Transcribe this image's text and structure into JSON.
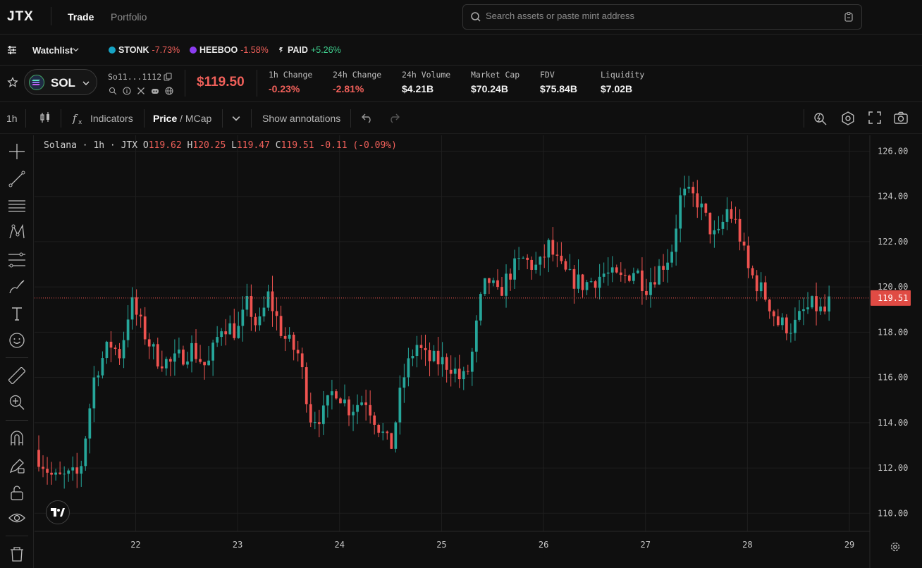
{
  "app": {
    "logo": "JTX",
    "nav": [
      {
        "label": "Trade",
        "active": true
      },
      {
        "label": "Portfolio",
        "active": false
      }
    ],
    "search_placeholder": "Search assets or paste mint address"
  },
  "watchlist": {
    "label": "Watchlist",
    "items": [
      {
        "symbol": "STONK",
        "change": "-7.73%",
        "color": "#16a3c4"
      },
      {
        "symbol": "HEEBOO",
        "change": "-1.58%",
        "color": "#8b3cf0"
      },
      {
        "symbol": "PAID",
        "change": "+5.26%",
        "color": "#cccccc"
      }
    ]
  },
  "token": {
    "symbol": "SOL",
    "address": "So11...1112",
    "price": "$119.50",
    "stats": [
      {
        "label": "1h Change",
        "value": "-0.23%",
        "tone": "neg"
      },
      {
        "label": "24h Change",
        "value": "-2.81%",
        "tone": "neg"
      },
      {
        "label": "24h Volume",
        "value": "$4.21B",
        "tone": "neutral"
      },
      {
        "label": "Market Cap",
        "value": "$70.24B",
        "tone": "neutral"
      },
      {
        "label": "FDV",
        "value": "$75.84B",
        "tone": "neutral"
      },
      {
        "label": "Liquidity",
        "value": "$7.02B",
        "tone": "neutral"
      }
    ]
  },
  "toolbar": {
    "interval": "1h",
    "indicators": "Indicators",
    "price": "Price",
    "slash": " / ",
    "mcap": "MCap",
    "annotations": "Show annotations"
  },
  "legend": {
    "prefix": "Solana · 1h · JTX",
    "o_label": "O",
    "o": "119.62",
    "h_label": "H",
    "h": "120.25",
    "l_label": "L",
    "l": "119.47",
    "c_label": "C",
    "c": "119.51",
    "chg": "-0.11 (-0.09%)"
  },
  "chart_data": {
    "type": "candlestick",
    "title": "",
    "interval": "1h",
    "ylim": [
      109.2,
      126.7
    ],
    "y_ticks": [
      "126.00",
      "124.00",
      "122.00",
      "120.00",
      "118.00",
      "116.00",
      "114.00",
      "112.00",
      "110.00"
    ],
    "x_ticks": [
      "22",
      "23",
      "24",
      "25",
      "26",
      "27",
      "28",
      "29"
    ],
    "x_tick_positions_days": [
      22,
      23,
      24,
      25,
      26,
      27,
      28,
      29
    ],
    "x_start_day": 21.05,
    "x_end_day": 29.2,
    "last_price": 119.51,
    "last_price_label": "119.51",
    "up_color": "#26a69a",
    "down_color": "#ef5350",
    "grid": true,
    "close_waypoints": [
      [
        21.05,
        112.5
      ],
      [
        21.2,
        111.5
      ],
      [
        21.45,
        111.7
      ],
      [
        21.6,
        116.2
      ],
      [
        21.75,
        117.5
      ],
      [
        21.85,
        117.0
      ],
      [
        21.95,
        119.4
      ],
      [
        22.05,
        118.3
      ],
      [
        22.2,
        116.9
      ],
      [
        22.35,
        116.6
      ],
      [
        22.55,
        117.3
      ],
      [
        22.7,
        116.4
      ],
      [
        22.85,
        118.4
      ],
      [
        23.0,
        118.0
      ],
      [
        23.1,
        119.3
      ],
      [
        23.2,
        118.1
      ],
      [
        23.3,
        119.6
      ],
      [
        23.45,
        117.8
      ],
      [
        23.6,
        117.0
      ],
      [
        23.72,
        114.2
      ],
      [
        23.85,
        114.4
      ],
      [
        23.95,
        115.6
      ],
      [
        24.1,
        114.6
      ],
      [
        24.25,
        115.1
      ],
      [
        24.4,
        113.7
      ],
      [
        24.5,
        112.8
      ],
      [
        24.62,
        115.9
      ],
      [
        24.75,
        117.5
      ],
      [
        24.85,
        116.8
      ],
      [
        25.0,
        116.7
      ],
      [
        25.1,
        116.5
      ],
      [
        25.2,
        115.8
      ],
      [
        25.28,
        116.5
      ],
      [
        25.38,
        119.3
      ],
      [
        25.45,
        120.4
      ],
      [
        25.55,
        119.6
      ],
      [
        25.68,
        120.7
      ],
      [
        25.8,
        121.2
      ],
      [
        25.95,
        120.8
      ],
      [
        26.05,
        121.8
      ],
      [
        26.15,
        120.9
      ],
      [
        26.25,
        120.4
      ],
      [
        26.4,
        120.1
      ],
      [
        26.6,
        120.6
      ],
      [
        26.75,
        120.3
      ],
      [
        26.9,
        120.8
      ],
      [
        27.0,
        120.0
      ],
      [
        27.1,
        120.6
      ],
      [
        27.25,
        121.5
      ],
      [
        27.35,
        124.1
      ],
      [
        27.5,
        123.9
      ],
      [
        27.6,
        122.9
      ],
      [
        27.7,
        122.0
      ],
      [
        27.8,
        123.4
      ],
      [
        27.9,
        122.7
      ],
      [
        28.0,
        120.8
      ],
      [
        28.1,
        120.1
      ],
      [
        28.2,
        119.4
      ],
      [
        28.3,
        118.4
      ],
      [
        28.45,
        118.2
      ],
      [
        28.55,
        118.9
      ],
      [
        28.65,
        119.2
      ],
      [
        28.75,
        118.8
      ],
      [
        28.82,
        119.5
      ]
    ]
  }
}
